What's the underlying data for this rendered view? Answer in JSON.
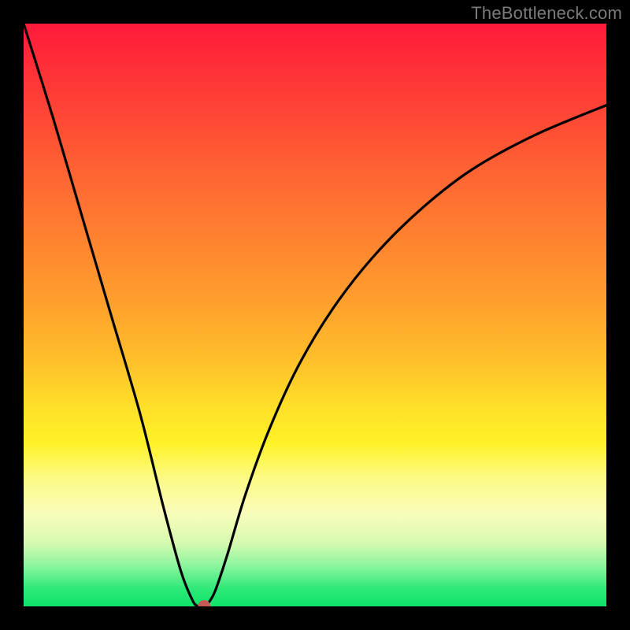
{
  "watermark": "TheBottleneck.com",
  "chart_data": {
    "type": "line",
    "title": "",
    "xlabel": "",
    "ylabel": "",
    "xlim": [
      0,
      100
    ],
    "ylim": [
      0,
      100
    ],
    "grid": false,
    "series": [
      {
        "name": "bottleneck-curve",
        "color": "#000000",
        "x": [
          0,
          5,
          10,
          15,
          20,
          24,
          27,
          29,
          30,
          31,
          32,
          33,
          35,
          38,
          42,
          47,
          53,
          60,
          68,
          77,
          88,
          100
        ],
        "values": [
          100,
          84,
          67,
          50,
          33,
          17,
          6,
          1,
          0,
          0,
          1,
          3,
          9,
          19,
          30,
          41,
          51,
          60,
          68,
          75,
          81,
          86
        ]
      }
    ],
    "marker": {
      "name": "bottleneck-point",
      "x": 31,
      "y": 0,
      "color": "#c75a56",
      "radius_px": 8
    },
    "background_gradient": {
      "top": "#ff1a3a",
      "bottom": "#0ee36a"
    }
  }
}
